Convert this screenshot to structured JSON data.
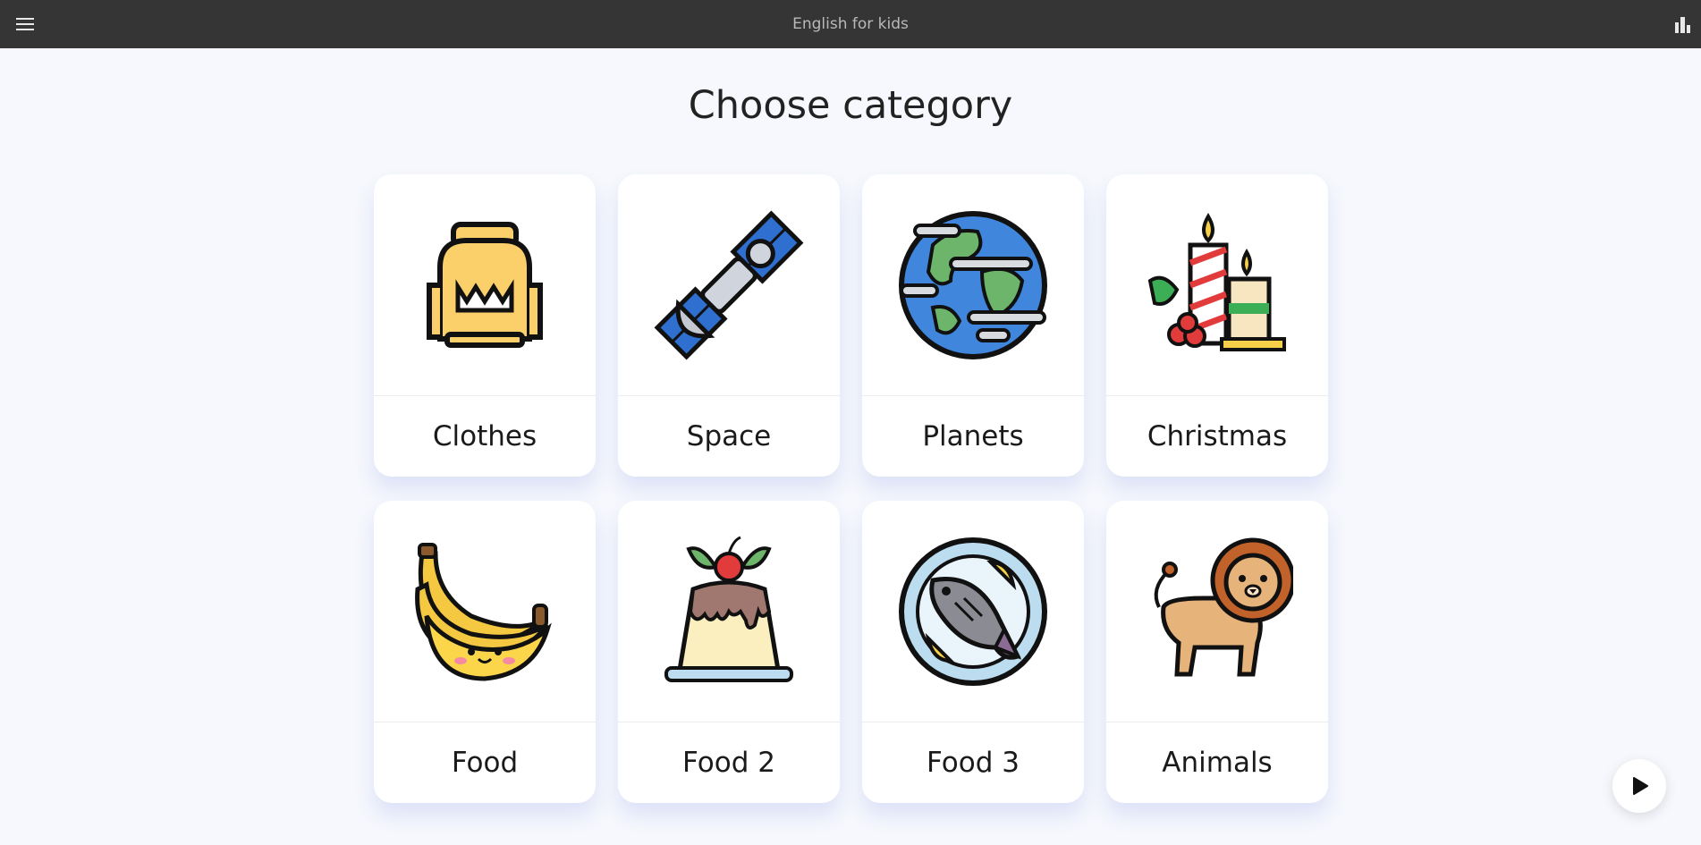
{
  "header": {
    "title": "English for kids",
    "menu_icon": "hamburger-menu-icon",
    "stats_icon": "bar-chart-icon"
  },
  "page": {
    "heading": "Choose category"
  },
  "categories": [
    {
      "label": "Clothes",
      "icon": "sweater-icon"
    },
    {
      "label": "Space",
      "icon": "satellite-icon"
    },
    {
      "label": "Planets",
      "icon": "earth-icon"
    },
    {
      "label": "Christmas",
      "icon": "candles-icon"
    },
    {
      "label": "Food",
      "icon": "banana-icon"
    },
    {
      "label": "Food 2",
      "icon": "pudding-icon"
    },
    {
      "label": "Food 3",
      "icon": "fish-plate-icon"
    },
    {
      "label": "Animals",
      "icon": "lion-icon"
    }
  ],
  "play_button": {
    "icon": "play-icon"
  }
}
